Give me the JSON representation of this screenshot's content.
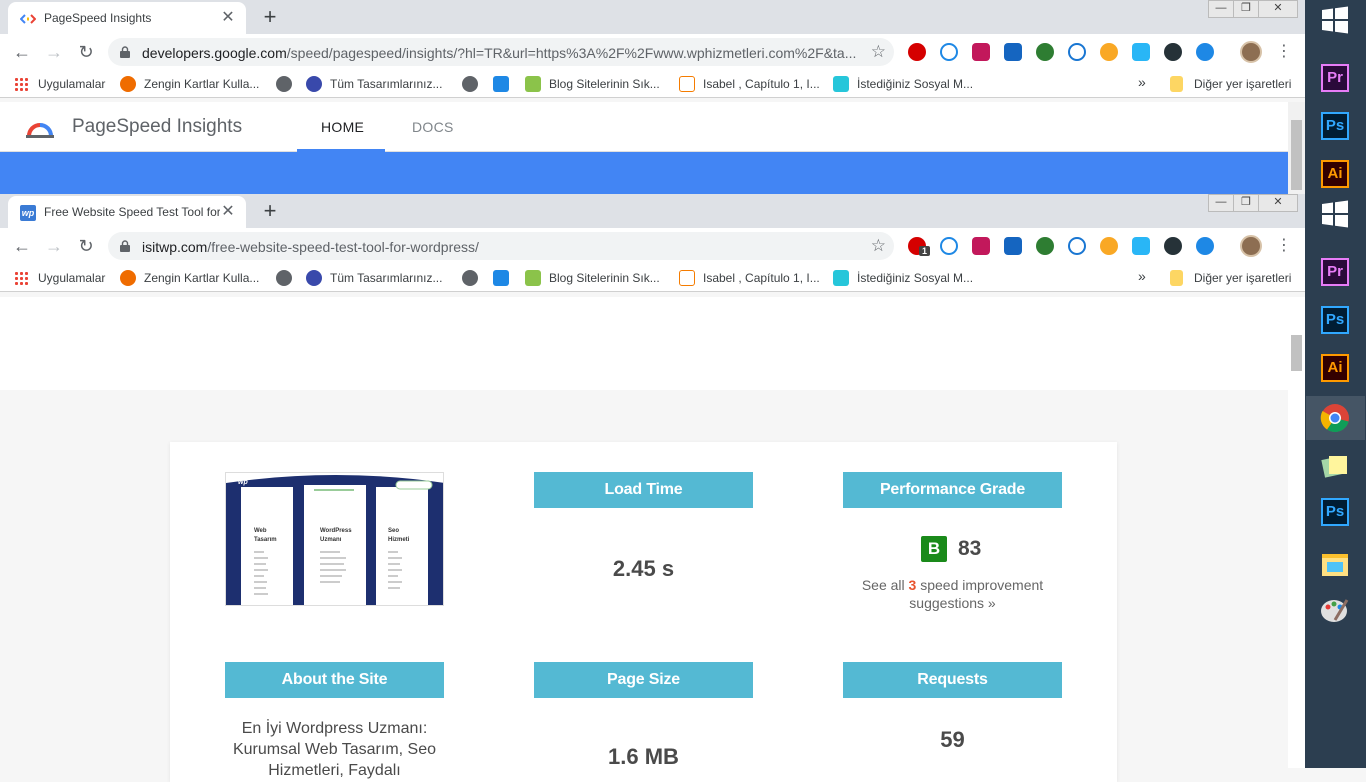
{
  "window1": {
    "tab_title": "PageSpeed Insights",
    "url_host": "developers.google.com",
    "url_rest": "/speed/pagespeed/insights/?hl=TR&url=https%3A%2F%2Fwww.wphizmetleri.com%2F&ta...",
    "site_title": "PageSpeed Insights",
    "nav": [
      "HOME",
      "DOCS"
    ],
    "accent": "#4285f4"
  },
  "window2": {
    "tab_title": "Free Website Speed Test Tool for",
    "url_host": "isitwp.com",
    "url_rest": "/free-website-speed-test-tool-for-wordpress/",
    "ext_badge": "1"
  },
  "bookmarks": {
    "items": [
      "Uygulamalar",
      "Zengin Kartlar Kulla...",
      "Tüm Tasarımlarınız...",
      "Blog Sitelerinin Sık...",
      "Isabel , Capítulo 1, I...",
      "İstediğiniz Sosyal M..."
    ],
    "more": "»",
    "other": "Diğer yer işaretleri"
  },
  "extensions": [
    "opera-icon",
    "infinity-icon",
    "d-icon",
    "s-icon",
    "green-icon",
    "a-icon",
    "spark-icon",
    "iq-icon",
    "rocket-icon",
    "link-icon"
  ],
  "results": {
    "load_time_label": "Load Time",
    "load_time": "2.45 s",
    "grade_label": "Performance Grade",
    "grade_letter": "B",
    "grade_score": "83",
    "sugg_pre": "See all",
    "sugg_count": "3",
    "sugg_post": "speed improvement suggestions »",
    "about_label": "About the Site",
    "about_text": "En İyi Wordpress Uzmanı: Kurumsal Web Tasarım, Seo Hizmetleri, Faydalı",
    "size_label": "Page Size",
    "size": "1.6 MB",
    "requests_label": "Requests",
    "requests": "59"
  },
  "thumbnail": {
    "logo": "wp",
    "cols": [
      {
        "title": "Web Tasarım"
      },
      {
        "title": "WordPress Uzmanı"
      },
      {
        "title": "Seo Hizmeti"
      }
    ]
  },
  "taskbar": [
    "windows-icon",
    "premiere-icon",
    "photoshop-icon",
    "illustrator-icon",
    "windows-icon",
    "premiere-icon",
    "photoshop-icon",
    "illustrator-icon",
    "chrome-icon",
    "sticky-notes-icon",
    "photoshop-icon",
    "file-explorer-icon",
    "paint-icon"
  ],
  "taskbar_labels": {
    "pr": "Pr",
    "ps": "Ps",
    "ai": "Ai"
  },
  "controls": {
    "minimize": "—",
    "restore": "❐",
    "close": "✕",
    "newtab": "+",
    "tabclose": "✕",
    "back": "←",
    "forward": "→",
    "reload": "↻",
    "star": "☆",
    "kebab": "⋮"
  }
}
